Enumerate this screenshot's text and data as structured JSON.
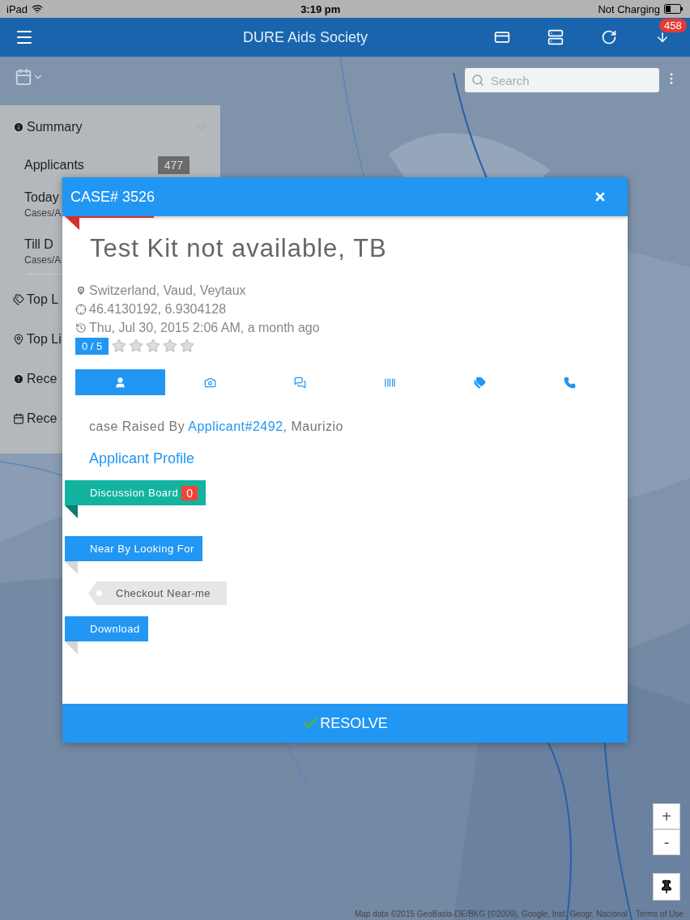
{
  "status_bar": {
    "device": "iPad",
    "time": "3:19 pm",
    "battery": "Not Charging"
  },
  "app_bar": {
    "title": "DURE Aids Society",
    "badge": "458"
  },
  "map": {
    "search": {
      "placeholder": "Search"
    },
    "zoom_in": "+",
    "zoom_out": "-",
    "attribution": "Map data ©2015 GeoBasis-DE/BKG (©2009), Google, Inst. Geogr. Nacional",
    "terms": "Terms of Use"
  },
  "sidebar": {
    "items": [
      {
        "kind": "group",
        "label": "Summary"
      },
      {
        "kind": "count",
        "label": "Applicants",
        "count": "477"
      },
      {
        "kind": "stat",
        "label": "Today",
        "sublabel": "Cases/A"
      },
      {
        "kind": "stat",
        "label": "Till D",
        "sublabel": "Cases/A"
      },
      {
        "kind": "heading",
        "label": "Top L"
      },
      {
        "kind": "heading",
        "label": "Top Li"
      },
      {
        "kind": "heading",
        "label": "Rece"
      },
      {
        "kind": "heading",
        "label": "Rece"
      }
    ]
  },
  "modal": {
    "case": "CASE# 3526",
    "title": "Test Kit not available, TB",
    "location": "Switzerland, Vaud, Veytaux",
    "coords": "46.4130192, 6.9304128",
    "time": "Thu, Jul 30, 2015 2:06 AM, a month ago",
    "rating": "0 / 5",
    "stars": 0,
    "tabs": [
      {
        "selected": true
      },
      {
        "selected": false
      },
      {
        "selected": false
      },
      {
        "selected": false
      },
      {
        "selected": false
      },
      {
        "selected": false
      }
    ],
    "raised_by": {
      "prefix": "case Raised By ",
      "link": "Applicant#2492",
      "suffix": ", Maurizio"
    },
    "profile_link": "Applicant Profile",
    "ribbons": [
      {
        "kind": "ribbon",
        "label": "Discussion Board",
        "count": "0",
        "color": "#13b3a0"
      },
      {
        "kind": "ribbon",
        "label": "Near By Looking For",
        "color": "#2196f3"
      },
      {
        "kind": "tag",
        "label": "Checkout Near-me"
      },
      {
        "kind": "ribbon",
        "label": "Download",
        "color": "#2196f3"
      }
    ],
    "resolve": "RESOLVE"
  }
}
